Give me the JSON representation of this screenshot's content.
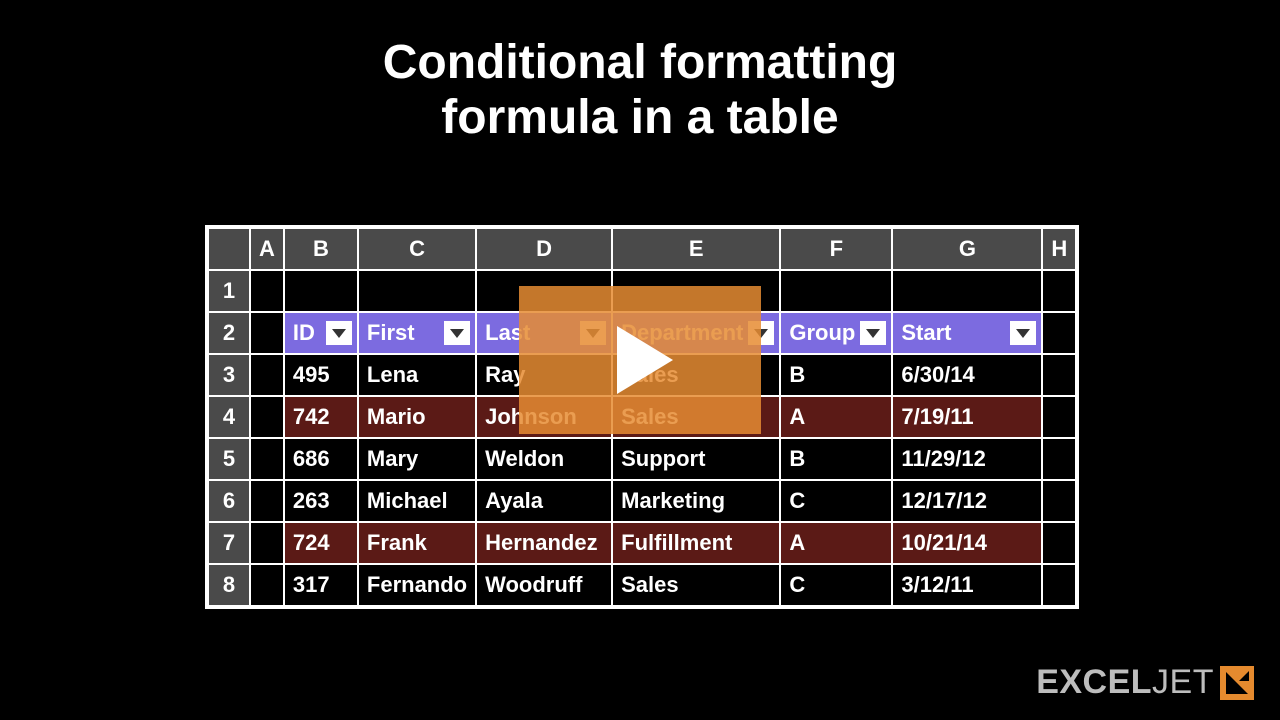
{
  "title_line1": "Conditional formatting",
  "title_line2": "formula in a table",
  "columns": [
    "A",
    "B",
    "C",
    "D",
    "E",
    "F",
    "G",
    "H"
  ],
  "row_numbers": [
    "1",
    "2",
    "3",
    "4",
    "5",
    "6",
    "7",
    "8"
  ],
  "headers": {
    "B": "ID",
    "C": "First",
    "D": "Last",
    "E": "Department",
    "F": "Group",
    "G": "Start"
  },
  "rows": [
    {
      "hl": false,
      "B": "495",
      "C": "Lena",
      "D": "Ray",
      "E": "Sales",
      "F": "B",
      "G": "6/30/14"
    },
    {
      "hl": true,
      "B": "742",
      "C": "Mario",
      "D": "Johnson",
      "E": "Sales",
      "F": "A",
      "G": "7/19/11"
    },
    {
      "hl": false,
      "B": "686",
      "C": "Mary",
      "D": "Weldon",
      "E": "Support",
      "F": "B",
      "G": "11/29/12"
    },
    {
      "hl": false,
      "B": "263",
      "C": "Michael",
      "D": "Ayala",
      "E": "Marketing",
      "F": "C",
      "G": "12/17/12"
    },
    {
      "hl": true,
      "B": "724",
      "C": "Frank",
      "D": "Hernandez",
      "E": "Fulfillment",
      "F": "A",
      "G": "10/21/14"
    },
    {
      "hl": false,
      "B": "317",
      "C": "Fernando",
      "D": "Woodruff",
      "E": "Sales",
      "F": "C",
      "G": "3/12/11"
    }
  ],
  "brand": {
    "name_bold": "EXCEL",
    "name_thin": "JET"
  }
}
